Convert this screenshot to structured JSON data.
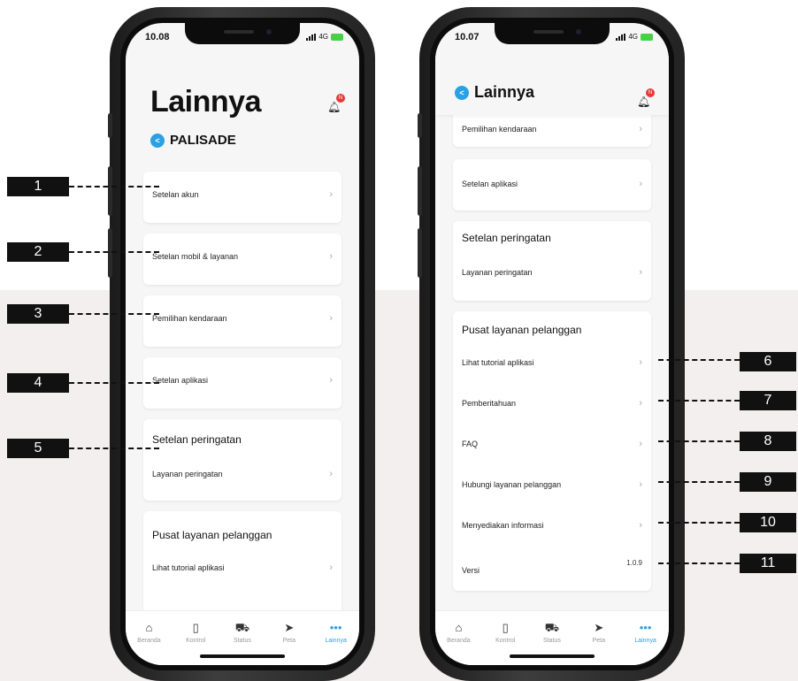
{
  "left_screen": {
    "time": "10.08",
    "network": "4G",
    "title": "Lainnya",
    "brand": "PALISADE",
    "bell_badge": "N",
    "items": [
      {
        "label": "Setelan akun"
      },
      {
        "label": "Setelan mobil & layanan"
      },
      {
        "label": "Pemilihan kendaraan"
      },
      {
        "label": "Setelan aplikasi"
      }
    ],
    "peringatan": {
      "heading": "Setelan peringatan",
      "item": "Layanan peringatan"
    },
    "pusat": {
      "heading": "Pusat layanan pelanggan",
      "item": "Lihat tutorial aplikasi"
    }
  },
  "right_screen": {
    "time": "10.07",
    "network": "4G",
    "title": "Lainnya",
    "bell_badge": "N",
    "items": [
      {
        "label": "Pemilihan kendaraan"
      },
      {
        "label": "Setelan aplikasi"
      }
    ],
    "peringatan": {
      "heading": "Setelan peringatan",
      "item": "Layanan peringatan"
    },
    "pusat": {
      "heading": "Pusat layanan pelanggan",
      "items": [
        {
          "label": "Lihat tutorial aplikasi"
        },
        {
          "label": "Pemberitahuan"
        },
        {
          "label": "FAQ"
        },
        {
          "label": "Hubungi layanan pelanggan"
        },
        {
          "label": "Menyediakan informasi"
        }
      ],
      "version_label": "Versi",
      "version_value": "1.0.9"
    }
  },
  "tabbar": [
    {
      "label": "Beranda",
      "icon": "home-icon"
    },
    {
      "label": "Kontrol",
      "icon": "remote-icon"
    },
    {
      "label": "Status",
      "icon": "car-icon"
    },
    {
      "label": "Peta",
      "icon": "navigation-icon"
    },
    {
      "label": "Lainnya",
      "icon": "more-icon",
      "active": true
    }
  ],
  "callouts": [
    "1",
    "2",
    "3",
    "4",
    "5",
    "6",
    "7",
    "8",
    "9",
    "10",
    "11"
  ],
  "colors": {
    "accent": "#2aa0e5",
    "badge": "#e53935",
    "band": "#f3efee"
  }
}
